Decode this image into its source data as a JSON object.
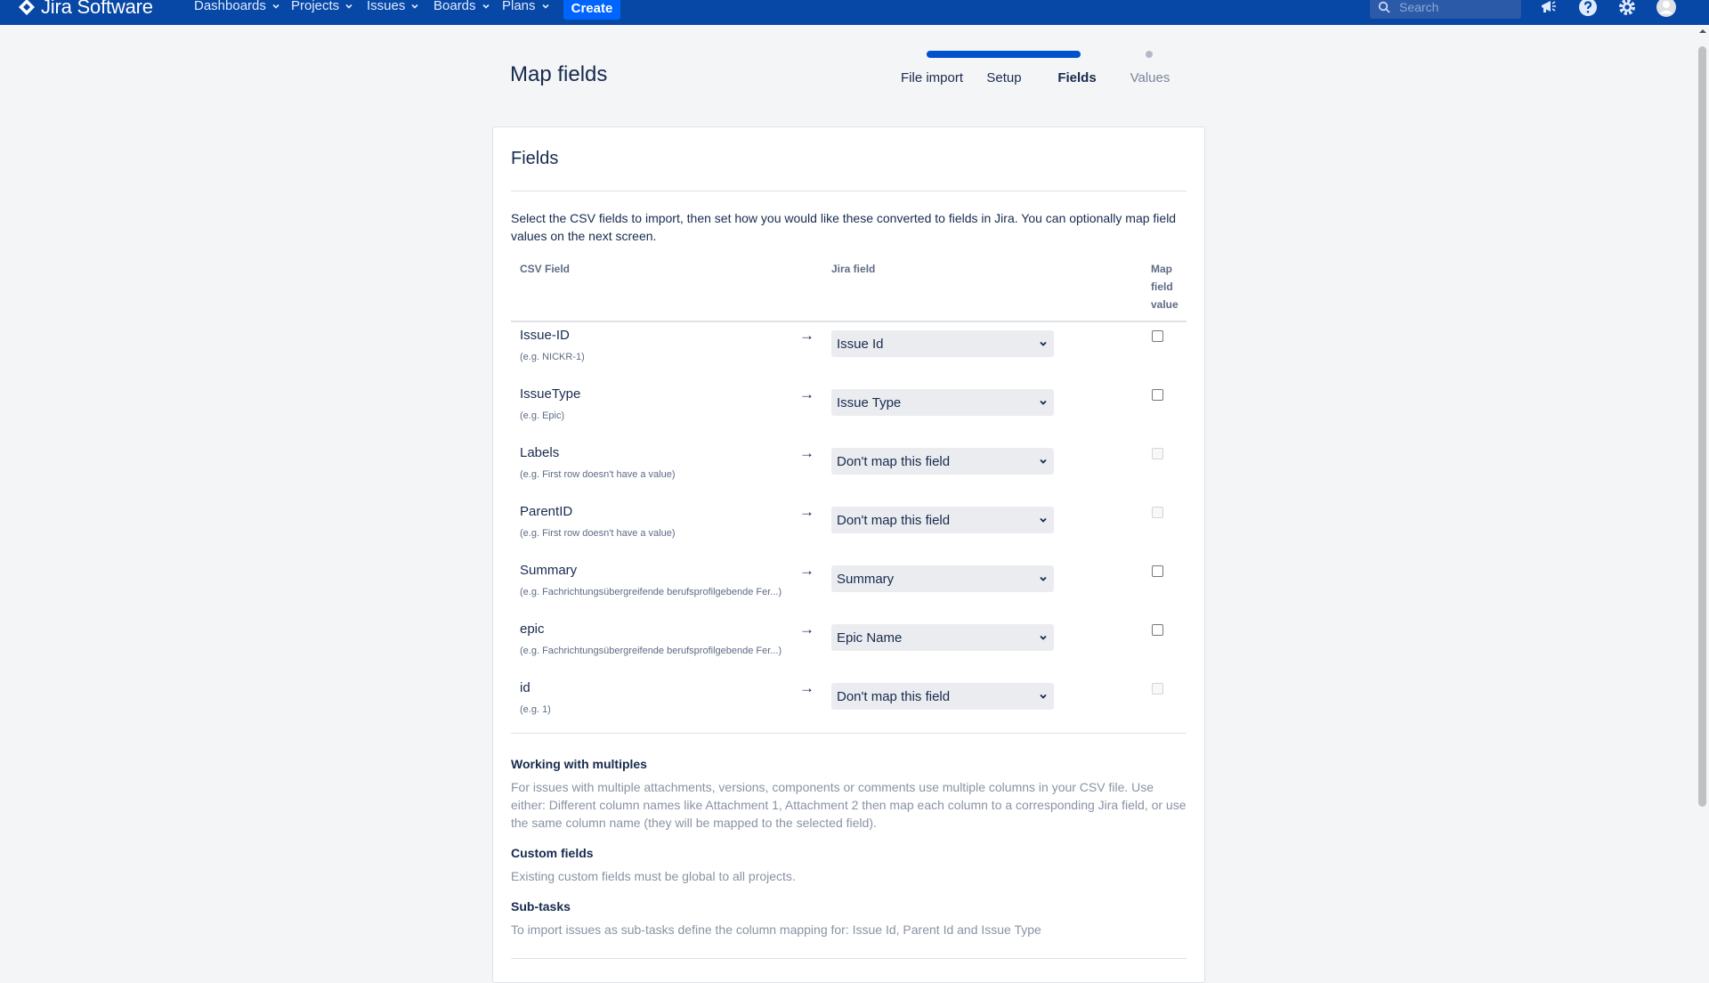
{
  "nav": {
    "logo_text": "Jira Software",
    "items": [
      {
        "label": "Dashboards"
      },
      {
        "label": "Projects"
      },
      {
        "label": "Issues"
      },
      {
        "label": "Boards"
      },
      {
        "label": "Plans"
      }
    ],
    "create_label": "Create",
    "search_placeholder": "Search",
    "icons": [
      "notifications-icon",
      "help-icon",
      "settings-icon",
      "profile-avatar"
    ]
  },
  "header": {
    "title": "Map fields",
    "steps": [
      {
        "label": "File import",
        "state": "done"
      },
      {
        "label": "Setup",
        "state": "done"
      },
      {
        "label": "Fields",
        "state": "current"
      },
      {
        "label": "Values",
        "state": "future"
      }
    ]
  },
  "card": {
    "title": "Fields",
    "intro": "Select the CSV fields to import, then set how you would like these converted to fields in Jira. You can optionally map field values on the next screen.",
    "columns": {
      "csv": "CSV Field",
      "jira": "Jira field",
      "map": "Map field value"
    },
    "rows": [
      {
        "name": "Issue-ID",
        "example": "(e.g.  NICKR-1)",
        "jira": "Issue Id",
        "map_checked": false,
        "map_disabled": false
      },
      {
        "name": "IssueType",
        "example": "(e.g.  Epic)",
        "jira": "Issue Type",
        "map_checked": false,
        "map_disabled": false
      },
      {
        "name": "Labels",
        "example": "(e.g.  First row doesn't have a value)",
        "jira": "Don't map this field",
        "map_checked": false,
        "map_disabled": true
      },
      {
        "name": "ParentID",
        "example": "(e.g.  First row doesn't have a value)",
        "jira": "Don't map this field",
        "map_checked": false,
        "map_disabled": true
      },
      {
        "name": "Summary",
        "example": "(e.g.  Fachrichtungsübergreifende berufsprofilgebende Fer...)",
        "jira": "Summary",
        "map_checked": false,
        "map_disabled": false
      },
      {
        "name": "epic",
        "example": "(e.g.  Fachrichtungsübergreifende berufsprofilgebende Fer...)",
        "jira": "Epic Name",
        "map_checked": false,
        "map_disabled": false
      },
      {
        "name": "id",
        "example": "(e.g.  1)",
        "jira": "Don't map this field",
        "map_checked": false,
        "map_disabled": true
      }
    ],
    "arrow": "→",
    "help": {
      "multiples_title": "Working with multiples",
      "multiples_text": "For issues with multiple attachments, versions, components or comments use multiple columns in your CSV file. Use either: Different column names like Attachment 1, Attachment 2 then map each column to a corresponding Jira field, or use the same column name (they will be mapped to the selected field).",
      "custom_title": "Custom fields",
      "custom_text": "Existing custom fields must be global to all projects.",
      "subtasks_title": "Sub-tasks",
      "subtasks_text": "To import issues as sub-tasks define the column mapping for: Issue Id, Parent Id and Issue Type"
    }
  },
  "colors": {
    "nav_bg": "#0747a6",
    "accent": "#0052cc",
    "create_bg": "#0065ff"
  }
}
